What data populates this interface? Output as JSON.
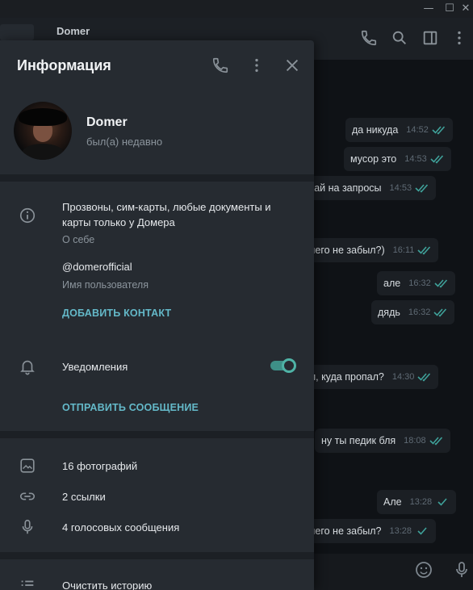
{
  "window": {
    "minimize": "—",
    "maximize": "☐",
    "close": "✕"
  },
  "chat": {
    "title": "Domer",
    "messages": [
      {
        "text": "да никуда",
        "time": "14:52"
      },
      {
        "text": "мусор это",
        "time": "14:53"
      },
      {
        "text": "чекай на запросы",
        "time": "14:53"
      },
      {
        "text": "ничего не забыл?)",
        "time": "16:11"
      },
      {
        "text": "але",
        "time": "16:32"
      },
      {
        "text": "дядь",
        "time": "16:32"
      },
      {
        "text": "бал, куда пропал?",
        "time": "14:30"
      },
      {
        "text": "ну ты педик бля",
        "time": "18:08"
      },
      {
        "text": "Але",
        "time": "13:28"
      },
      {
        "text": "ничего не забыл?",
        "time": "13:28"
      }
    ]
  },
  "info": {
    "title": "Информация",
    "name": "Domer",
    "status": "был(а) недавно",
    "bio": "Прозвоны, сим-карты, любые документы и карты только у Домера",
    "bio_label": "О себе",
    "username": "@domerofficial",
    "username_label": "Имя пользователя",
    "add_contact": "ДОБАВИТЬ КОНТАКТ",
    "notifications": "Уведомления",
    "notifications_enabled": true,
    "send_message": "ОТПРАВИТЬ СООБЩЕНИЕ",
    "photos": "16 фотографий",
    "links": "2 ссылки",
    "voice": "4 голосовых сообщения",
    "clear_history": "Очистить историю"
  },
  "colors": {
    "accent": "#64b9c9",
    "check": "#3fa29a",
    "panel": "#262b31"
  }
}
